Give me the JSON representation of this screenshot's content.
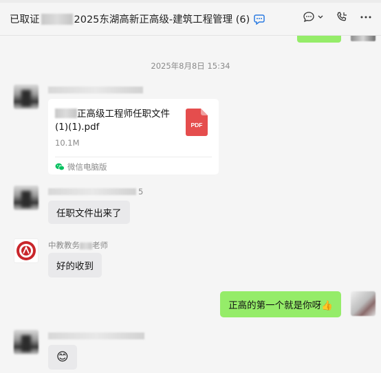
{
  "header": {
    "title_prefix": "已取证",
    "title_suffix": "2025东湖高新正高级-建筑工程管理 (6)",
    "icons": [
      "chat-bubble-icon",
      "chevron-down-icon",
      "phone-icon",
      "more-icon"
    ]
  },
  "messages": {
    "timestamp": "2025年8月8日 15:34",
    "file": {
      "name_visible": "正高级工程师任职文件(1)(1).pdf",
      "size": "10.1M",
      "type_label": "PDF",
      "source": "微信电脑版"
    },
    "msg2": {
      "sender_suffix": "5",
      "text": "任职文件出来了"
    },
    "msg3": {
      "sender_prefix": "中教教务",
      "sender_suffix": "老师",
      "text": "好的收到"
    },
    "msg4": {
      "text": "正高的第一个就是你呀👍"
    },
    "msg5": {
      "emoji": "😊"
    }
  },
  "colors": {
    "self_bubble": "#95ec69",
    "other_bubble": "#e9e9eb",
    "pdf_red": "#e54d4d",
    "wechat_green": "#07c160"
  }
}
